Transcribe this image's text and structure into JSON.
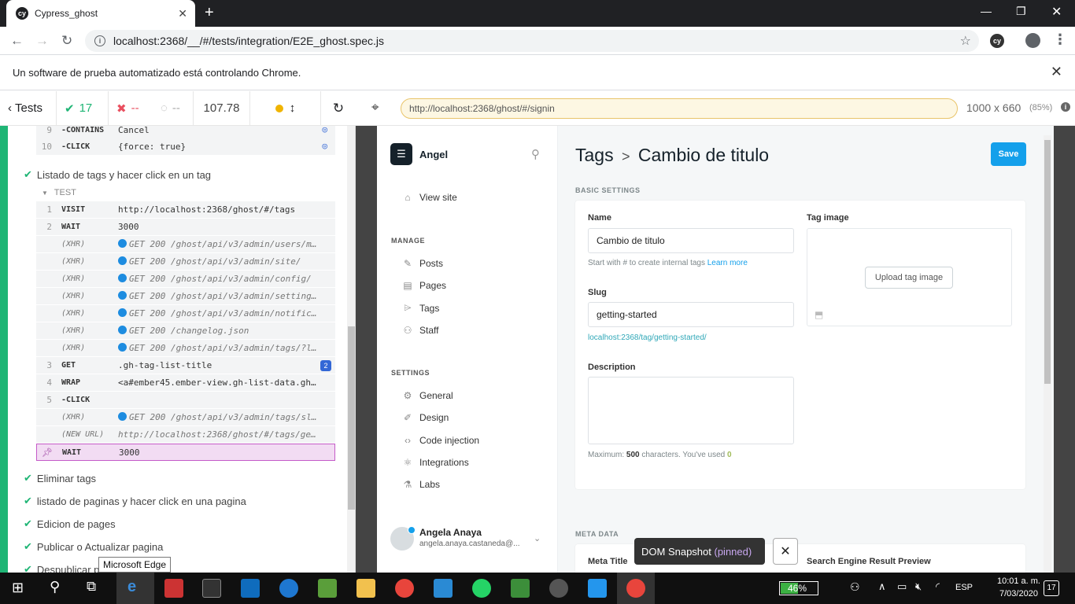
{
  "browser": {
    "tab_title": "Cypress_ghost",
    "url": "localhost:2368/__/#/tests/integration/E2E_ghost.spec.js",
    "infobar_text": "Un software de prueba automatizado está controlando Chrome."
  },
  "reporter": {
    "tests_label": "Tests",
    "passed": "17",
    "failed": "--",
    "pending": "--",
    "duration": "107.78",
    "commands_top": [
      {
        "n": "9",
        "name": "-CONTAINS",
        "msg": "Cancel"
      },
      {
        "n": "10",
        "name": "-CLICK",
        "msg": "{force: true}"
      }
    ],
    "active_test": "Listado de tags y hacer click en un tag",
    "test_label": "TEST",
    "commands": [
      {
        "n": "1",
        "name": "VISIT",
        "msg": "http://localhost:2368/ghost/#/tags"
      },
      {
        "n": "2",
        "name": "WAIT",
        "msg": "3000"
      },
      {
        "n": "",
        "name": "(XHR)",
        "msg": "GET 200 /ghost/api/v3/admin/users/me..."
      },
      {
        "n": "",
        "name": "(XHR)",
        "msg": "GET 200 /ghost/api/v3/admin/site/"
      },
      {
        "n": "",
        "name": "(XHR)",
        "msg": "GET 200 /ghost/api/v3/admin/config/"
      },
      {
        "n": "",
        "name": "(XHR)",
        "msg": "GET 200 /ghost/api/v3/admin/settings..."
      },
      {
        "n": "",
        "name": "(XHR)",
        "msg": "GET 200 /ghost/api/v3/admin/notifica..."
      },
      {
        "n": "",
        "name": "(XHR)",
        "msg": "GET 200 /changelog.json"
      },
      {
        "n": "",
        "name": "(XHR)",
        "msg": "GET 200 /ghost/api/v3/admin/tags/?l..."
      },
      {
        "n": "3",
        "name": "GET",
        "msg": ".gh-tag-list-title",
        "badge": "2"
      },
      {
        "n": "4",
        "name": "WRAP",
        "msg": "<a#ember45.ember-view.gh-list-data.gh-t..."
      },
      {
        "n": "5",
        "name": "-CLICK",
        "msg": ""
      },
      {
        "n": "",
        "name": "(XHR)",
        "msg": "GET 200 /ghost/api/v3/admin/tags/slu..."
      },
      {
        "n": "",
        "name": "(NEW URL)",
        "msg": "http://localhost:2368/ghost/#/tags/gett..."
      },
      {
        "n": "",
        "name": "WAIT",
        "msg": "3000"
      }
    ],
    "other_tests": [
      "Eliminar tags",
      "listado de paginas y hacer click en una pagina",
      "Edicion de pages",
      "Publicar o Actualizar pagina",
      "Despublicar p"
    ],
    "tooltip": "Microsoft Edge"
  },
  "aut": {
    "url": "http://localhost:2368/ghost/#/signin",
    "viewport": "1000 x 660",
    "scale": "(85%)"
  },
  "ghost": {
    "site_name": "Angel",
    "view_site": "View site",
    "manage_label": "MANAGE",
    "manage_items": [
      "Posts",
      "Pages",
      "Tags",
      "Staff"
    ],
    "settings_label": "SETTINGS",
    "settings_items": [
      "General",
      "Design",
      "Code injection",
      "Integrations",
      "Labs"
    ],
    "user_name": "Angela Anaya",
    "user_email": "angela.anaya.castaneda@...",
    "breadcrumb_parent": "Tags",
    "breadcrumb_sep": ">",
    "title": "Cambio de titulo",
    "save_label": "Save",
    "basic_settings": "BASIC SETTINGS",
    "name_label": "Name",
    "name_value": "Cambio de titulo",
    "name_hint": "Start with # to create internal tags",
    "learn_more": "Learn more",
    "slug_label": "Slug",
    "slug_value": "getting-started",
    "slug_url": "localhost:2368/tag/getting-started/",
    "tag_image_label": "Tag image",
    "upload_label": "Upload tag image",
    "description_label": "Description",
    "desc_hint_pre": "Maximum:",
    "desc_max": "500",
    "desc_hint_mid": "characters. You've used",
    "desc_used": "0",
    "meta_data": "META DATA",
    "meta_title_label": "Meta Title",
    "serp_label": "Search Engine Result Preview"
  },
  "snapshot": {
    "label": "DOM Snapshot",
    "pinned": "(pinned)"
  },
  "taskbar": {
    "battery": "46%",
    "lang": "ESP",
    "time": "10:01 a. m.",
    "date": "7/03/2020",
    "notif": "17"
  }
}
